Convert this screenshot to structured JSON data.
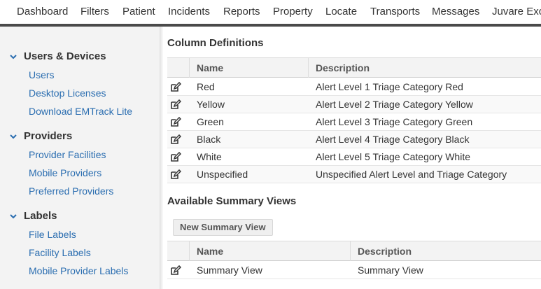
{
  "topnav": {
    "items": [
      "Dashboard",
      "Filters",
      "Patient",
      "Incidents",
      "Reports",
      "Property",
      "Locate",
      "Transports",
      "Messages",
      "Juvare Exc"
    ]
  },
  "sidebar": {
    "sections": [
      {
        "title": "Users & Devices",
        "links": [
          "Users",
          "Desktop Licenses",
          "Download EMTrack Lite"
        ]
      },
      {
        "title": "Providers",
        "links": [
          "Provider Facilities",
          "Mobile Providers",
          "Preferred Providers"
        ]
      },
      {
        "title": "Labels",
        "links": [
          "File Labels",
          "Facility Labels",
          "Mobile Provider Labels"
        ]
      }
    ]
  },
  "column_definitions": {
    "title": "Column Definitions",
    "headers": {
      "name": "Name",
      "description": "Description"
    },
    "rows": [
      {
        "name": "Red",
        "description": "Alert Level 1 Triage Category Red"
      },
      {
        "name": "Yellow",
        "description": "Alert Level 2 Triage Category Yellow"
      },
      {
        "name": "Green",
        "description": "Alert Level 3 Triage Category Green"
      },
      {
        "name": "Black",
        "description": "Alert Level 4 Triage Category Black"
      },
      {
        "name": "White",
        "description": "Alert Level 5 Triage Category White"
      },
      {
        "name": "Unspecified",
        "description": "Unspecified Alert Level and Triage Category"
      }
    ],
    "row_icon": "edit-icon"
  },
  "summary_views": {
    "title": "Available Summary Views",
    "new_button": "New Summary View",
    "headers": {
      "name": "Name",
      "description": "Description"
    },
    "rows": [
      {
        "name": "Summary View",
        "description": "Summary View"
      }
    ],
    "row_icon": "edit-icon"
  },
  "colors": {
    "link": "#2a6db0",
    "chevron": "#2a6db0",
    "nav_bar": "#4a4a4a"
  }
}
